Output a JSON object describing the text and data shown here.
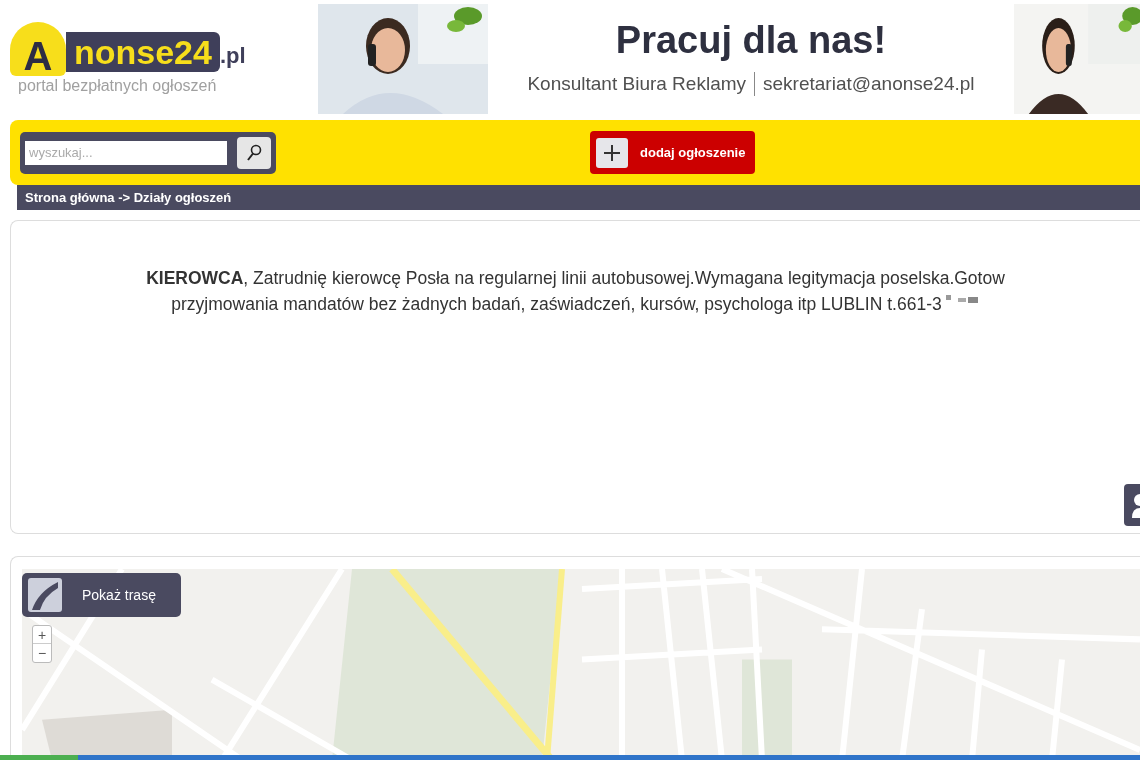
{
  "logo": {
    "letter": "A",
    "brand": "nonse24",
    "tld": ".pl",
    "tagline": "portal bezpłatnych ogłoszeń"
  },
  "banner": {
    "headline": "Pracuj dla nas!",
    "role": "Konsultant Biura Reklamy",
    "email": "sekretariat@anonse24.pl"
  },
  "search": {
    "placeholder": "wyszukaj..."
  },
  "add_button": {
    "label": "dodaj ogłoszenie"
  },
  "breadcrumb": "Strona główna -> Działy ogłoszeń",
  "ad": {
    "lines": [
      "**KIEROWCA**, Zatrudnię kierowcę Posła na regularnej linii autobusowej.Wymagana legitymacja poselska.Gotow",
      "przyjmowania mandatów bez żadnych badań, zaświadczeń, kursów, psychologa itp LUBLIN t.661-3"
    ]
  },
  "map": {
    "route_button": "Pokaż trasę",
    "zoom_in": "+",
    "zoom_out": "−"
  }
}
